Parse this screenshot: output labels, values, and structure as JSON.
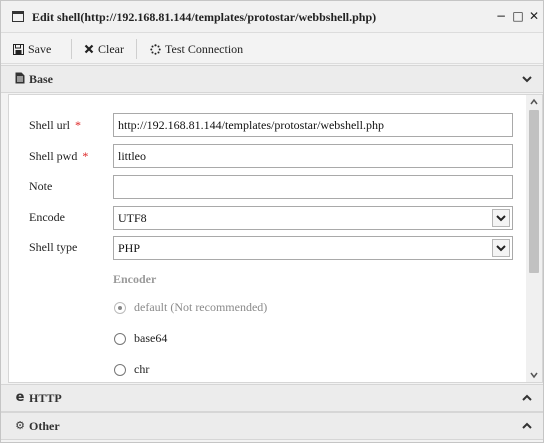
{
  "window": {
    "title": "Edit shell(http://192.168.81.144/templates/protostar/webbshell.php)",
    "controls": {
      "minimize": "−",
      "maximize": "□",
      "close": "✕"
    }
  },
  "toolbar": {
    "save_label": "Save",
    "clear_label": "Clear",
    "test_label": "Test Connection"
  },
  "sections": {
    "base": {
      "label": "Base",
      "icon": "file-icon",
      "state": "expanded"
    },
    "http": {
      "label": "HTTP",
      "icon": "edge-icon",
      "state": "collapsed"
    },
    "other": {
      "label": "Other",
      "icon": "gears-icon",
      "state": "collapsed"
    }
  },
  "form": {
    "shell_url": {
      "label": "Shell url",
      "required": "*",
      "value": "http://192.168.81.144/templates/protostar/webshell.php"
    },
    "shell_pwd": {
      "label": "Shell pwd",
      "required": "*",
      "value": "littleo"
    },
    "note": {
      "label": "Note",
      "value": ""
    },
    "encode": {
      "label": "Encode",
      "value": "UTF8"
    },
    "shell_type": {
      "label": "Shell type",
      "value": "PHP"
    },
    "encoder": {
      "label": "Encoder",
      "options": [
        {
          "label": "default (Not recommended)",
          "checked": true,
          "disabled": true
        },
        {
          "label": "base64",
          "checked": false,
          "disabled": false
        },
        {
          "label": "chr",
          "checked": false,
          "disabled": false
        }
      ]
    }
  },
  "colors": {
    "required": "#dd2222",
    "muted": "#9a9a9a"
  }
}
